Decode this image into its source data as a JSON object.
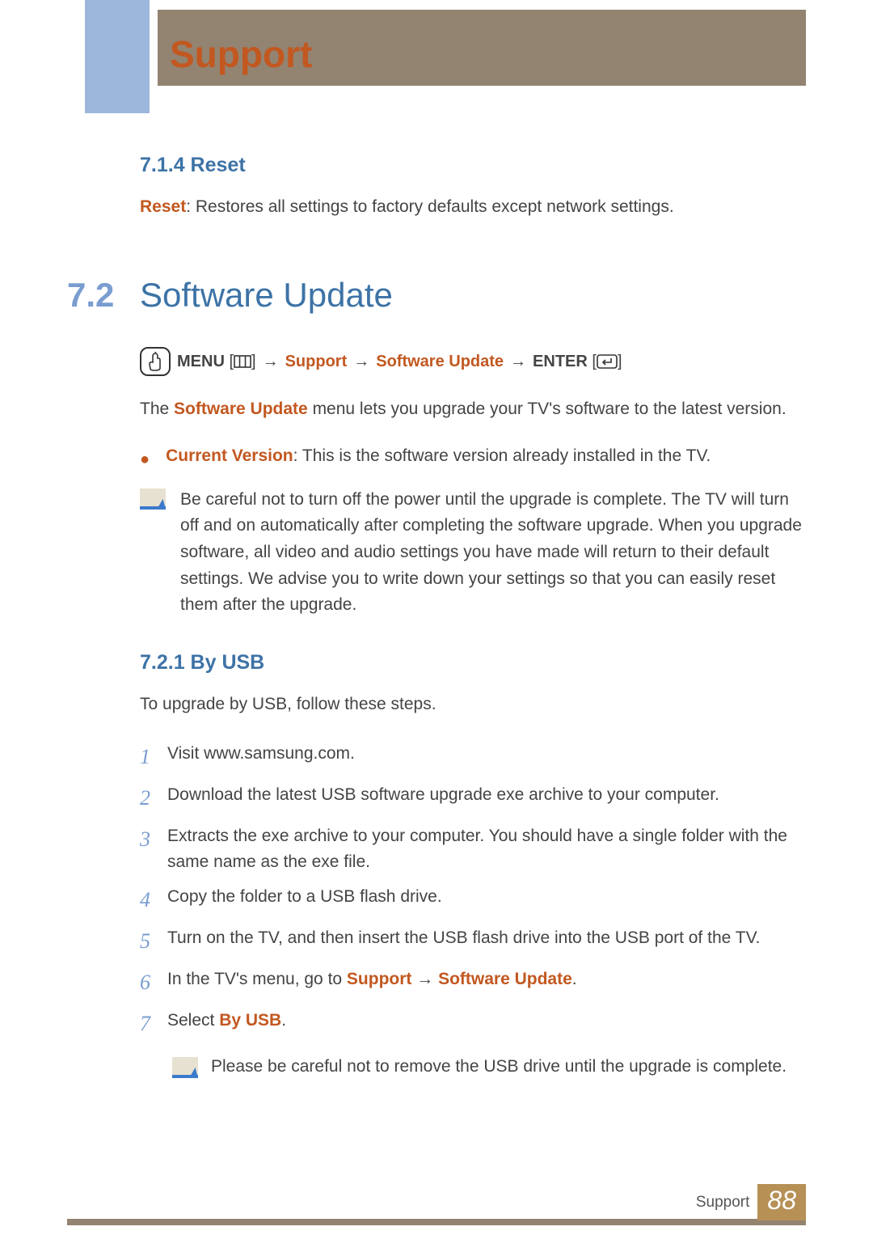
{
  "chapter_title": "Support",
  "s714": {
    "heading": "7.1.4  Reset",
    "reset_label": "Reset",
    "reset_desc": ": Restores all settings to factory defaults except network settings."
  },
  "s72": {
    "number": "7.2",
    "title": "Software Update",
    "menu_path": {
      "menu": "MENU",
      "m1": "[",
      "m2": "]",
      "support": "Support",
      "software_update": "Software Update",
      "enter": "ENTER",
      "e1": "[",
      "e2": "]"
    },
    "intro_prefix": "The ",
    "intro_highlight": "Software Update",
    "intro_suffix": " menu lets you upgrade your TV's software to the latest version.",
    "cv_label": "Current Version",
    "cv_desc": ": This is the software version already installed in the TV.",
    "note1": "Be careful not to turn off the power until the upgrade is complete. The TV will turn off and on automatically after completing the software upgrade. When you upgrade software, all video and audio settings you have made will return to their default settings. We advise you to write down your settings so that you can easily reset them after the upgrade."
  },
  "s721": {
    "heading": "7.2.1  By USB",
    "intro": "To upgrade by USB, follow these steps.",
    "steps": [
      "Visit www.samsung.com.",
      "Download the latest USB software upgrade exe archive to your computer.",
      "Extracts the exe archive to your computer. You should have a single folder with the same name as the exe file.",
      "Copy the folder to a USB flash drive.",
      "Turn on the TV, and then insert the USB flash drive into the USB port of the TV."
    ],
    "step6_prefix": "In the TV's menu, go to ",
    "step6_support": "Support",
    "step6_arrow": " → ",
    "step6_su": "Software Update",
    "step6_period": ".",
    "step7_prefix": "Select ",
    "step7_byusb": "By USB",
    "step7_period": ".",
    "note2": "Please be careful not to remove the USB drive until the upgrade is complete."
  },
  "footer": {
    "label": "Support",
    "page": "88"
  }
}
